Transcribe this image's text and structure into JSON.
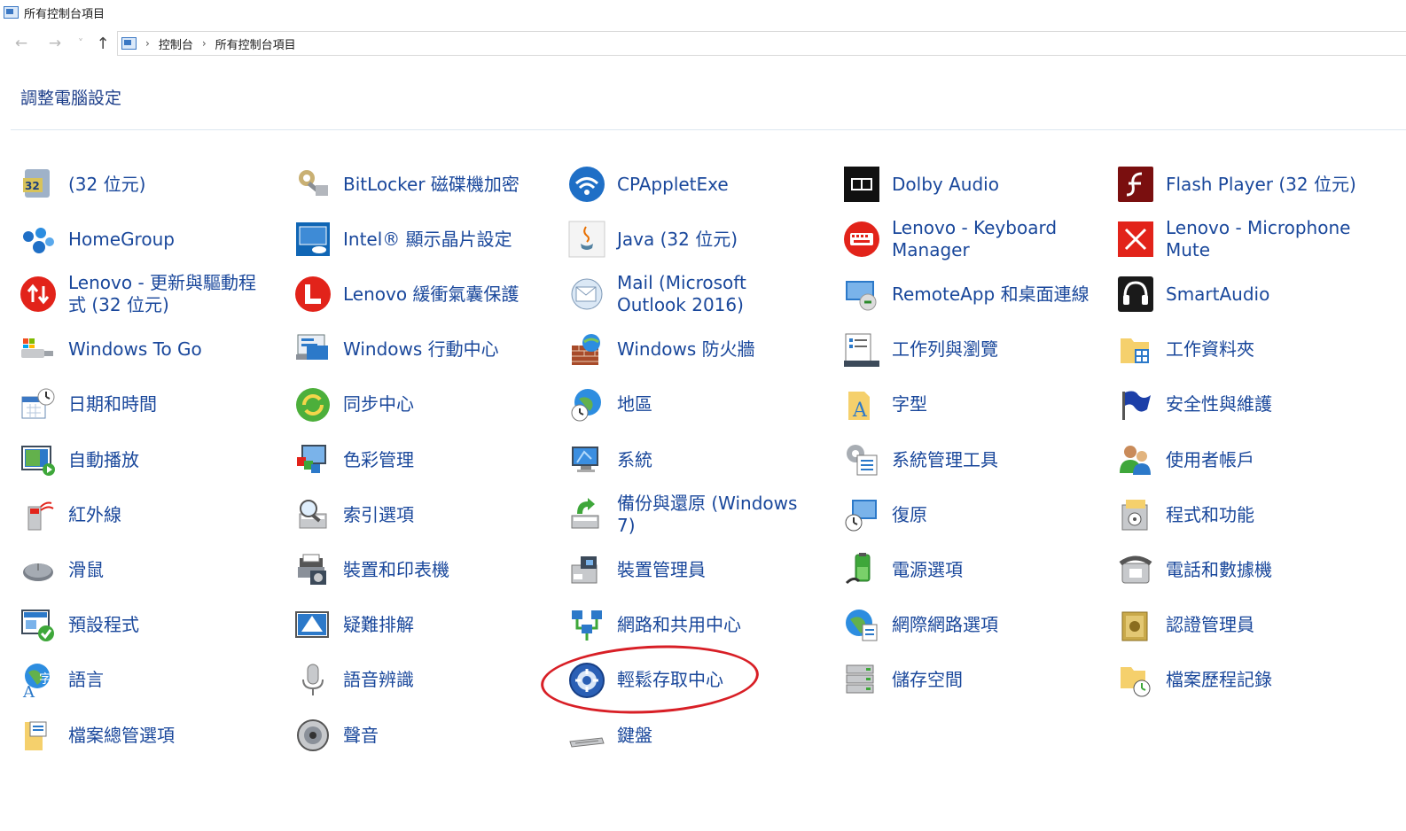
{
  "window": {
    "title": "所有控制台項目"
  },
  "nav": {
    "back": "←",
    "forward": "→",
    "recent": "˅",
    "up": "↑"
  },
  "address": {
    "crumbs": [
      "控制台",
      "所有控制台項目"
    ],
    "separator": "›"
  },
  "heading": "調整電腦設定",
  "items": [
    {
      "label": "(32 位元)",
      "icon": "32bit-icon"
    },
    {
      "label": "BitLocker 磁碟機加密",
      "icon": "bitlocker-key-icon"
    },
    {
      "label": "CPAppletExe",
      "icon": "wifi-icon"
    },
    {
      "label": "Dolby Audio",
      "icon": "dolby-icon"
    },
    {
      "label": "Flash Player (32 位元)",
      "icon": "flash-icon"
    },
    {
      "label": "HomeGroup",
      "icon": "homegroup-icon"
    },
    {
      "label": "Intel® 顯示晶片設定",
      "icon": "intel-icon"
    },
    {
      "label": "Java (32 位元)",
      "icon": "java-icon"
    },
    {
      "label": "Lenovo - Keyboard Manager",
      "icon": "keyboard-manager-icon"
    },
    {
      "label": "Lenovo - Microphone Mute",
      "icon": "microphone-mute-icon"
    },
    {
      "label": "Lenovo - 更新與驅動程式 (32 位元)",
      "icon": "lenovo-update-icon"
    },
    {
      "label": "Lenovo 緩衝氣囊保護",
      "icon": "airbag-icon"
    },
    {
      "label": "Mail (Microsoft Outlook 2016)",
      "icon": "mail-icon"
    },
    {
      "label": "RemoteApp 和桌面連線",
      "icon": "remoteapp-icon"
    },
    {
      "label": "SmartAudio",
      "icon": "headphones-icon"
    },
    {
      "label": "Windows To Go",
      "icon": "usb-drive-icon"
    },
    {
      "label": "Windows 行動中心",
      "icon": "mobility-center-icon"
    },
    {
      "label": "Windows 防火牆",
      "icon": "firewall-icon"
    },
    {
      "label": "工作列與瀏覽",
      "icon": "taskbar-icon"
    },
    {
      "label": "工作資料夾",
      "icon": "work-folders-icon"
    },
    {
      "label": "日期和時間",
      "icon": "calendar-clock-icon"
    },
    {
      "label": "同步中心",
      "icon": "sync-icon"
    },
    {
      "label": "地區",
      "icon": "globe-clock-icon"
    },
    {
      "label": "字型",
      "icon": "font-folder-icon"
    },
    {
      "label": "安全性與維護",
      "icon": "flag-icon"
    },
    {
      "label": "自動播放",
      "icon": "autoplay-icon"
    },
    {
      "label": "色彩管理",
      "icon": "color-management-icon"
    },
    {
      "label": "系統",
      "icon": "system-icon"
    },
    {
      "label": "系統管理工具",
      "icon": "admin-tools-icon"
    },
    {
      "label": "使用者帳戶",
      "icon": "user-accounts-icon"
    },
    {
      "label": "紅外線",
      "icon": "infrared-icon"
    },
    {
      "label": "索引選項",
      "icon": "indexing-icon"
    },
    {
      "label": "備份與還原 (Windows 7)",
      "icon": "backup-icon"
    },
    {
      "label": "復原",
      "icon": "recovery-icon"
    },
    {
      "label": "程式和功能",
      "icon": "programs-icon"
    },
    {
      "label": "滑鼠",
      "icon": "mouse-icon"
    },
    {
      "label": "裝置和印表機",
      "icon": "devices-printers-icon"
    },
    {
      "label": "裝置管理員",
      "icon": "device-manager-icon"
    },
    {
      "label": "電源選項",
      "icon": "power-options-icon"
    },
    {
      "label": "電話和數據機",
      "icon": "phone-modem-icon"
    },
    {
      "label": "預設程式",
      "icon": "default-programs-icon"
    },
    {
      "label": "疑難排解",
      "icon": "troubleshooting-icon"
    },
    {
      "label": "網路和共用中心",
      "icon": "network-sharing-icon"
    },
    {
      "label": "網際網路選項",
      "icon": "internet-options-icon"
    },
    {
      "label": "認證管理員",
      "icon": "credential-manager-icon"
    },
    {
      "label": "語言",
      "icon": "language-icon"
    },
    {
      "label": "語音辨識",
      "icon": "microphone-icon"
    },
    {
      "label": "輕鬆存取中心",
      "icon": "ease-of-access-icon"
    },
    {
      "label": "儲存空間",
      "icon": "storage-spaces-icon"
    },
    {
      "label": "檔案歷程記錄",
      "icon": "file-history-icon"
    },
    {
      "label": "檔案總管選項",
      "icon": "file-explorer-options-icon"
    },
    {
      "label": "聲音",
      "icon": "speaker-icon"
    },
    {
      "label": "鍵盤",
      "icon": "keyboard-icon"
    }
  ],
  "colors": {
    "link": "#19479b",
    "heading": "#1e3f8a",
    "highlight": "#d81f26"
  }
}
